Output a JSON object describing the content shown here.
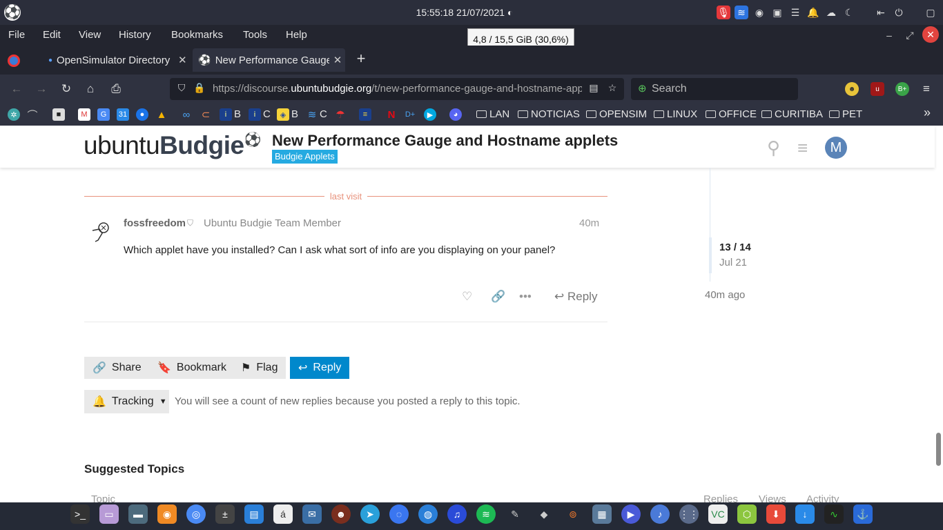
{
  "system": {
    "clock": "15:55:18  21/07/2021"
  },
  "menubar": {
    "file": "File",
    "edit": "Edit",
    "view": "View",
    "history": "History",
    "bookmarks": "Bookmarks",
    "tools": "Tools",
    "help": "Help"
  },
  "tooltip": "4,8 / 15,5 GiB (30,6%)",
  "tabs": [
    {
      "label": "OpenSimulator Directory"
    },
    {
      "label": "New Performance Gauge and Hostname applets"
    }
  ],
  "url": {
    "prefix": "https://discourse.",
    "domain": "ubuntubudgie.org",
    "path": "/t/new-performance-gauge-and-hostname-applets"
  },
  "search": {
    "placeholder": "Search"
  },
  "bookmarks": {
    "itau_b": "B",
    "itau_c": "C",
    "bb_b": "B",
    "bb_c": "C",
    "folders": [
      "LAN",
      "NOTICIAS",
      "OPENSIM",
      "LINUX",
      "OFFICE",
      "CURITIBA",
      "PET"
    ]
  },
  "site": {
    "logo_ubuntu": "ubuntu",
    "logo_budgie": "Budgie",
    "topic_title": "New Performance Gauge and Hostname applets",
    "category": "Budgie Applets",
    "avatar_letter": "M"
  },
  "post": {
    "last_visit": "last visit",
    "username": "fossfreedom",
    "user_title": "Ubuntu Budgie Team Member",
    "time": "40m",
    "body": "Which applet have you installed? Can I ask what sort of info are you displaying on your panel?",
    "reply": "Reply"
  },
  "timeline": {
    "count": "13 / 14",
    "date": "Jul 21",
    "ago": "40m ago"
  },
  "footer_buttons": {
    "share": "Share",
    "bookmark": "Bookmark",
    "flag": "Flag",
    "reply": "Reply"
  },
  "notifications": {
    "level": "Tracking",
    "note": "You will see a count of new replies because you posted a reply to this topic."
  },
  "suggested": {
    "title": "Suggested Topics",
    "columns": [
      "Topic",
      "Replies",
      "Views",
      "Activity"
    ]
  }
}
